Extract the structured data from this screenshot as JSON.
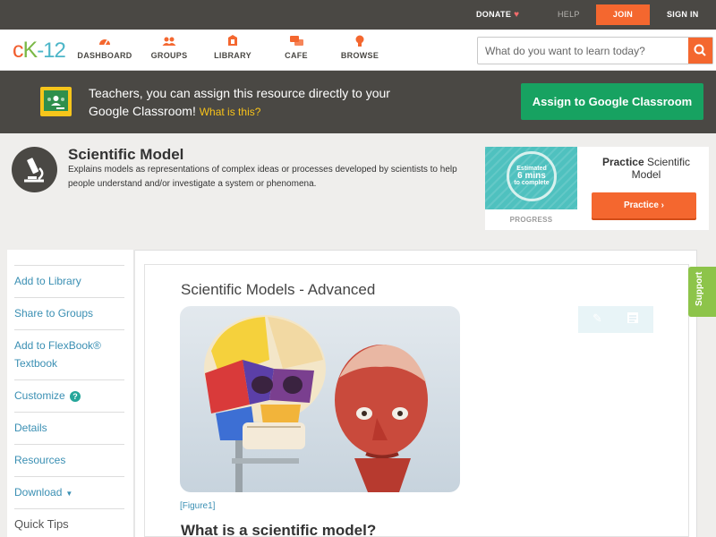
{
  "topbar": {
    "donate": "DONATE",
    "help": "HELP",
    "join": "JOIN",
    "signin": "SIGN IN"
  },
  "logo": {
    "c": "c",
    "k": "K",
    "n": "-12"
  },
  "nav": [
    {
      "label": "DASHBOARD",
      "icon": "speedometer-icon"
    },
    {
      "label": "GROUPS",
      "icon": "people-icon"
    },
    {
      "label": "LIBRARY",
      "icon": "library-icon"
    },
    {
      "label": "CAFE",
      "icon": "chat-icon"
    },
    {
      "label": "BROWSE",
      "icon": "lightbulb-icon"
    }
  ],
  "search": {
    "placeholder": "What do you want to learn today?"
  },
  "banner": {
    "text": "Teachers, you can assign this resource directly to your Google Classroom!",
    "what": "What is this?",
    "button": "Assign to Google Classroom"
  },
  "concept": {
    "title": "Scientific Model",
    "description": "Explains models as representations of complex ideas or processes developed by scientists to help people understand and/or investigate a system or phenomena."
  },
  "practice": {
    "estimated": "Estimated",
    "mins": "6 mins",
    "complete": "to complete",
    "progress_label": "PROGRESS",
    "name_bold": "Practice",
    "name_rest": "Scientific Model",
    "button": "Practice"
  },
  "sidebar": [
    {
      "label": "Add to Library"
    },
    {
      "label": "Share to Groups"
    },
    {
      "label": "Add to FlexBook® Textbook"
    },
    {
      "label": "Customize"
    },
    {
      "label": "Details"
    },
    {
      "label": "Resources"
    },
    {
      "label": "Download"
    },
    {
      "label": "Quick Tips"
    }
  ],
  "article": {
    "title": "Scientific Models - Advanced",
    "figure_caption": "[Figure1]",
    "section_heading": "What is a scientific model?"
  },
  "support": "Support",
  "colors": {
    "accent": "#f4672f",
    "dark": "#4a4844",
    "green": "#17a261",
    "link": "#3a8fb3"
  }
}
